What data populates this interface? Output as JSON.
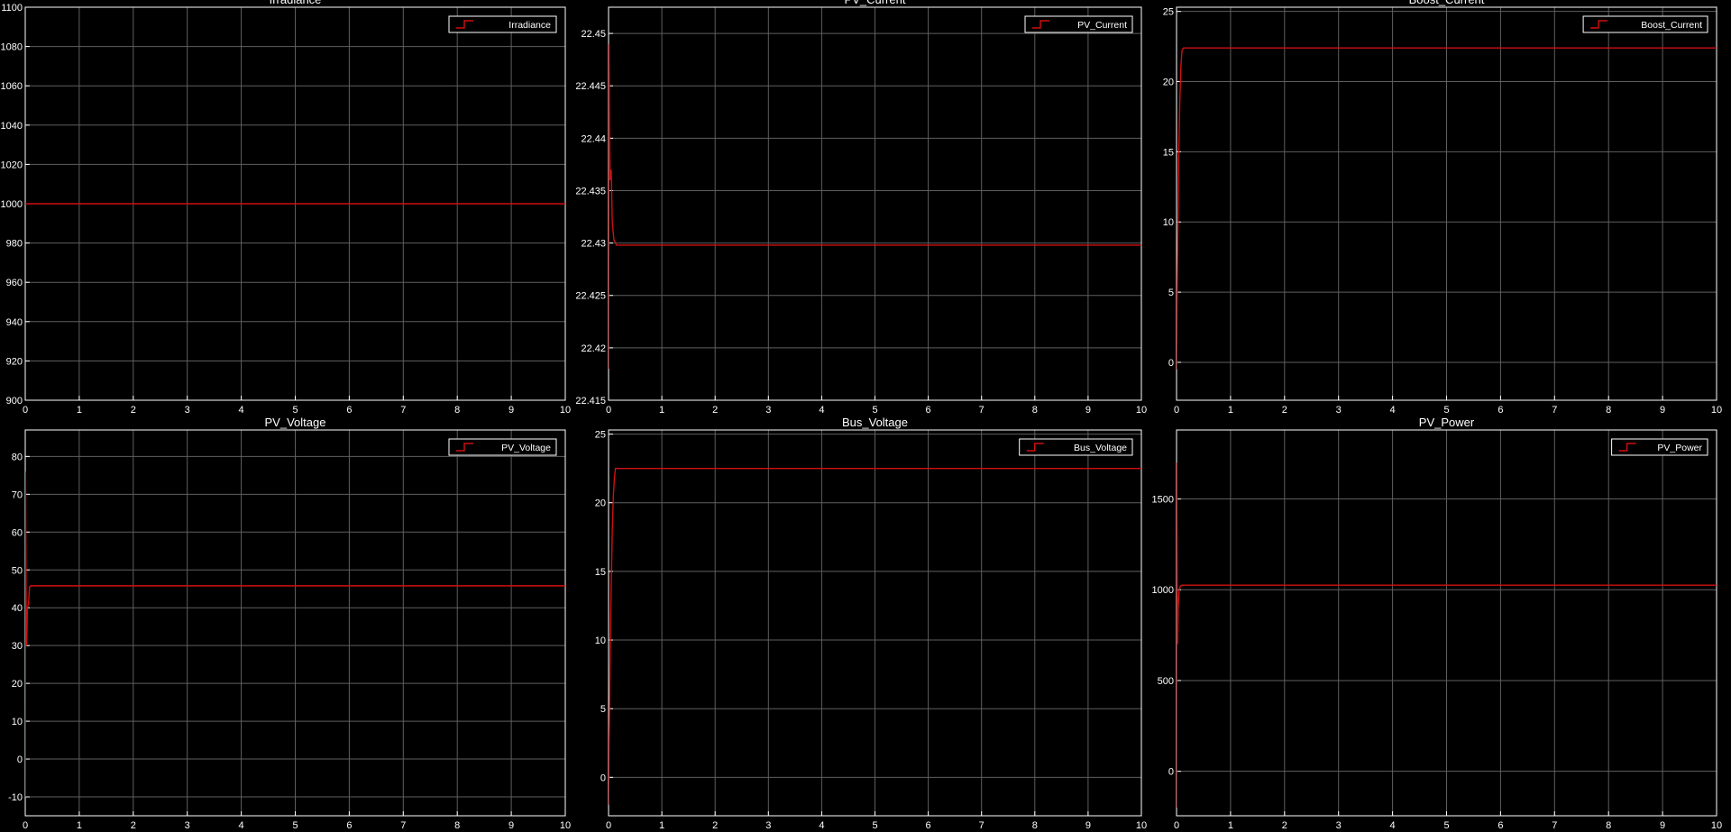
{
  "window": {
    "background": "#000000",
    "axes_color": "#ffffff",
    "grid_color": "#5f5f5f",
    "signal_color": "#d01010"
  },
  "chart_data": [
    {
      "type": "line",
      "title": "Irradiance",
      "legend": "Irradiance",
      "legend_position": "top-right",
      "grid": true,
      "xlim": [
        0,
        10
      ],
      "ylim": [
        900,
        1100
      ],
      "xticks": [
        0,
        1,
        2,
        3,
        4,
        5,
        6,
        7,
        8,
        9,
        10
      ],
      "yticks": [
        900,
        920,
        940,
        960,
        980,
        1000,
        1020,
        1040,
        1060,
        1080,
        1100
      ],
      "tick_labels": [
        "900",
        "920",
        "940",
        "960",
        "980",
        "1000",
        "1020",
        "1040",
        "1060",
        "1080",
        "1100"
      ],
      "series": [
        {
          "name": "Irradiance",
          "x": [
            0,
            10
          ],
          "y": [
            1000,
            1000
          ]
        }
      ]
    },
    {
      "type": "line",
      "title": "PV_Current",
      "legend": "PV_Current",
      "legend_position": "top-right",
      "grid": true,
      "xlim": [
        0,
        10
      ],
      "ylim": [
        22.415,
        22.4525
      ],
      "xticks": [
        0,
        1,
        2,
        3,
        4,
        5,
        6,
        7,
        8,
        9,
        10
      ],
      "yticks": [
        22.415,
        22.42,
        22.425,
        22.43,
        22.435,
        22.44,
        22.445,
        22.45
      ],
      "tick_labels": [
        "22.415",
        "22.42",
        "22.425",
        "22.43",
        "22.435",
        "22.44",
        "22.445",
        "22.45"
      ],
      "series": [
        {
          "name": "PV_Current",
          "x": [
            0,
            0.01,
            0.02,
            0.03,
            0.05,
            0.07,
            0.1,
            0.15,
            10
          ],
          "y": [
            22.418,
            22.449,
            22.44,
            22.436,
            22.437,
            22.432,
            22.4303,
            22.4298,
            22.4298
          ]
        }
      ]
    },
    {
      "type": "line",
      "title": "Boost_Current",
      "legend": "Boost_Current",
      "legend_position": "top-right",
      "grid": true,
      "xlim": [
        0,
        10
      ],
      "ylim": [
        -2.7,
        25.3
      ],
      "xticks": [
        0,
        1,
        2,
        3,
        4,
        5,
        6,
        7,
        8,
        9,
        10
      ],
      "yticks": [
        0,
        5,
        10,
        15,
        20,
        25
      ],
      "tick_labels": [
        "0",
        "5",
        "10",
        "15",
        "20",
        "25"
      ],
      "series": [
        {
          "name": "Boost_Current",
          "x": [
            0,
            0.02,
            0.04,
            0.06,
            0.08,
            0.1,
            0.13,
            10
          ],
          "y": [
            -0.5,
            8,
            14.5,
            18.5,
            21,
            22.2,
            22.4,
            22.4
          ]
        }
      ]
    },
    {
      "type": "line",
      "title": "PV_Voltage",
      "legend": "PV_Voltage",
      "legend_position": "top-right",
      "grid": true,
      "xlim": [
        0,
        10
      ],
      "ylim": [
        -15,
        87
      ],
      "xticks": [
        0,
        1,
        2,
        3,
        4,
        5,
        6,
        7,
        8,
        9,
        10
      ],
      "yticks": [
        -10,
        0,
        10,
        20,
        30,
        40,
        50,
        60,
        70,
        80
      ],
      "tick_labels": [
        "-10",
        "0",
        "10",
        "20",
        "30",
        "40",
        "50",
        "60",
        "70",
        "80"
      ],
      "series": [
        {
          "name": "PV_Voltage",
          "x": [
            0,
            0.005,
            0.01,
            0.02,
            0.03,
            0.04,
            0.06,
            0.08,
            0.1,
            10
          ],
          "y": [
            -10,
            76,
            60,
            30,
            32,
            40,
            41,
            45.5,
            45.8,
            45.8
          ]
        }
      ]
    },
    {
      "type": "line",
      "title": "Bus_Voltage",
      "legend": "Bus_Voltage",
      "legend_position": "top-right",
      "grid": true,
      "xlim": [
        0,
        10
      ],
      "ylim": [
        -2.8,
        25.3
      ],
      "xticks": [
        0,
        1,
        2,
        3,
        4,
        5,
        6,
        7,
        8,
        9,
        10
      ],
      "yticks": [
        0,
        5,
        10,
        15,
        20,
        25
      ],
      "tick_labels": [
        "0",
        "5",
        "10",
        "15",
        "20",
        "25"
      ],
      "series": [
        {
          "name": "Bus_Voltage",
          "x": [
            0,
            0.01,
            0.03,
            0.05,
            0.07,
            0.09,
            0.11,
            0.13,
            10
          ],
          "y": [
            -2,
            2,
            9,
            14,
            18,
            20.5,
            21.8,
            22.5,
            22.5
          ]
        }
      ]
    },
    {
      "type": "line",
      "title": "PV_Power",
      "legend": "PV_Power",
      "legend_position": "top-right",
      "grid": true,
      "xlim": [
        0,
        10
      ],
      "ylim": [
        -245,
        1880
      ],
      "xticks": [
        0,
        1,
        2,
        3,
        4,
        5,
        6,
        7,
        8,
        9,
        10
      ],
      "yticks": [
        0,
        500,
        1000,
        1500
      ],
      "tick_labels": [
        "0",
        "500",
        "1000",
        "1500"
      ],
      "series": [
        {
          "name": "PV_Power",
          "x": [
            0,
            0.005,
            0.01,
            0.02,
            0.03,
            0.05,
            0.07,
            0.1,
            10
          ],
          "y": [
            -200,
            1700,
            1300,
            700,
            900,
            1000,
            1020,
            1025,
            1025
          ]
        }
      ]
    }
  ]
}
